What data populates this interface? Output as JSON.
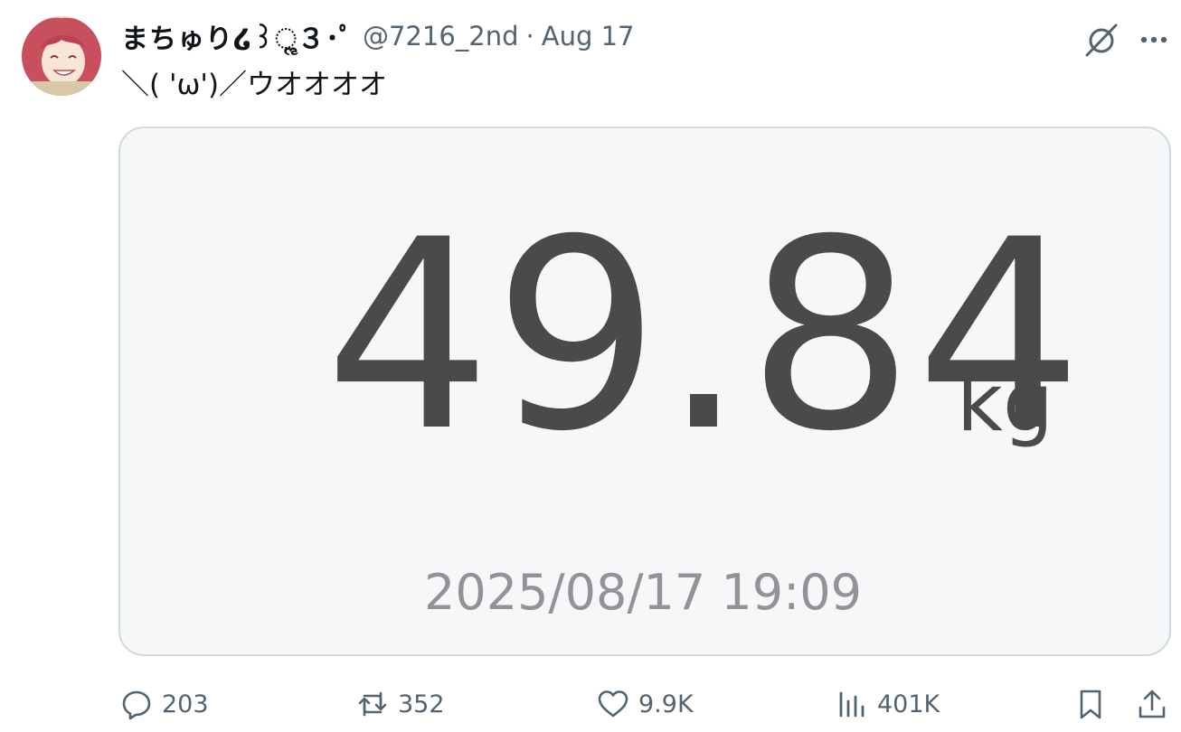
{
  "tweet": {
    "display_name": "まちゅり໒꒱ૢ３･ﾟ",
    "handle": "@7216_2nd",
    "separator": "·",
    "date": "Aug 17",
    "text": "＼( 'ω')／ウオオオオ"
  },
  "media": {
    "weight_value": "49.84",
    "weight_unit": "kg",
    "timestamp": "2025/08/17 19:09"
  },
  "actions": {
    "replies": "203",
    "reposts": "352",
    "likes": "9.9K",
    "views": "401K"
  },
  "icons": {
    "avatar": "avatar",
    "grok": "grok-icon",
    "more": "more-icon",
    "reply": "reply-icon",
    "repost": "repost-icon",
    "like": "heart-icon",
    "views": "views-icon",
    "bookmark": "bookmark-icon",
    "share": "share-icon"
  },
  "colors": {
    "text_primary": "#0f1419",
    "text_secondary": "#536471",
    "card_border": "#cfd9de",
    "card_background": "#f6f7f9",
    "weight_text": "#4a4a4b",
    "timestamp_text": "#929396"
  }
}
